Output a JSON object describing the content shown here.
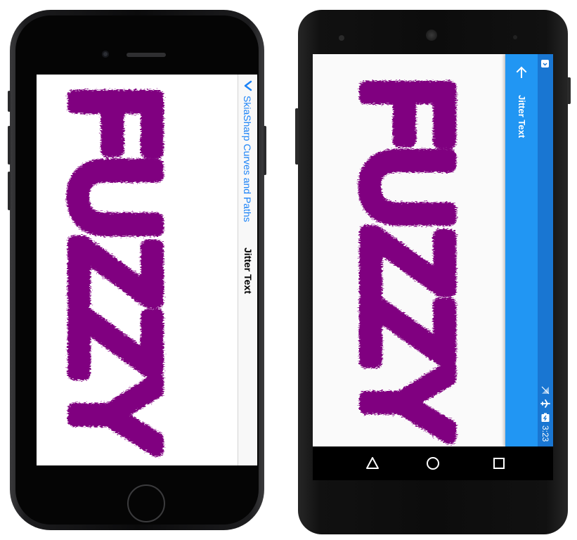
{
  "ios": {
    "back_label": "SkiaSharp Curves and Paths",
    "title": "Jitter Text",
    "accent": "#1a82f7"
  },
  "android": {
    "title": "Jitter Text",
    "time": "3:23",
    "toolbar_color": "#2196f3",
    "status_color": "#1976d2",
    "icons": [
      "arrow-back-icon",
      "download-icon",
      "no-sim-icon",
      "airplane-mode-icon",
      "battery-charging-icon"
    ],
    "nav_icons": [
      "back-triangle-icon",
      "home-circle-icon",
      "recents-square-icon"
    ]
  },
  "canvas_text": "FUZZY",
  "text_color": "#800080"
}
